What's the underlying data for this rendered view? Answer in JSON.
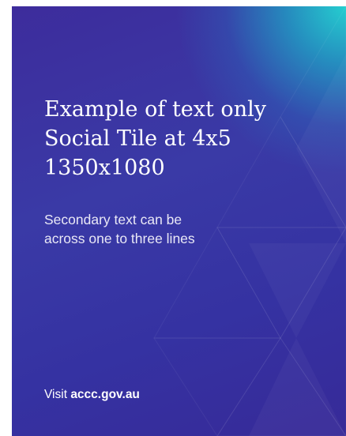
{
  "tile": {
    "headline": "Example of text only\nSocial Tile at 4x5\n1350x1080",
    "secondary": "Secondary text can be\nacross one to three lines",
    "cta_prefix": "Visit ",
    "cta_link": "accc.gov.au"
  },
  "colors": {
    "background_base": "#3a36a2",
    "accent_gradient": "#24d6d2",
    "text": "#ffffff"
  }
}
